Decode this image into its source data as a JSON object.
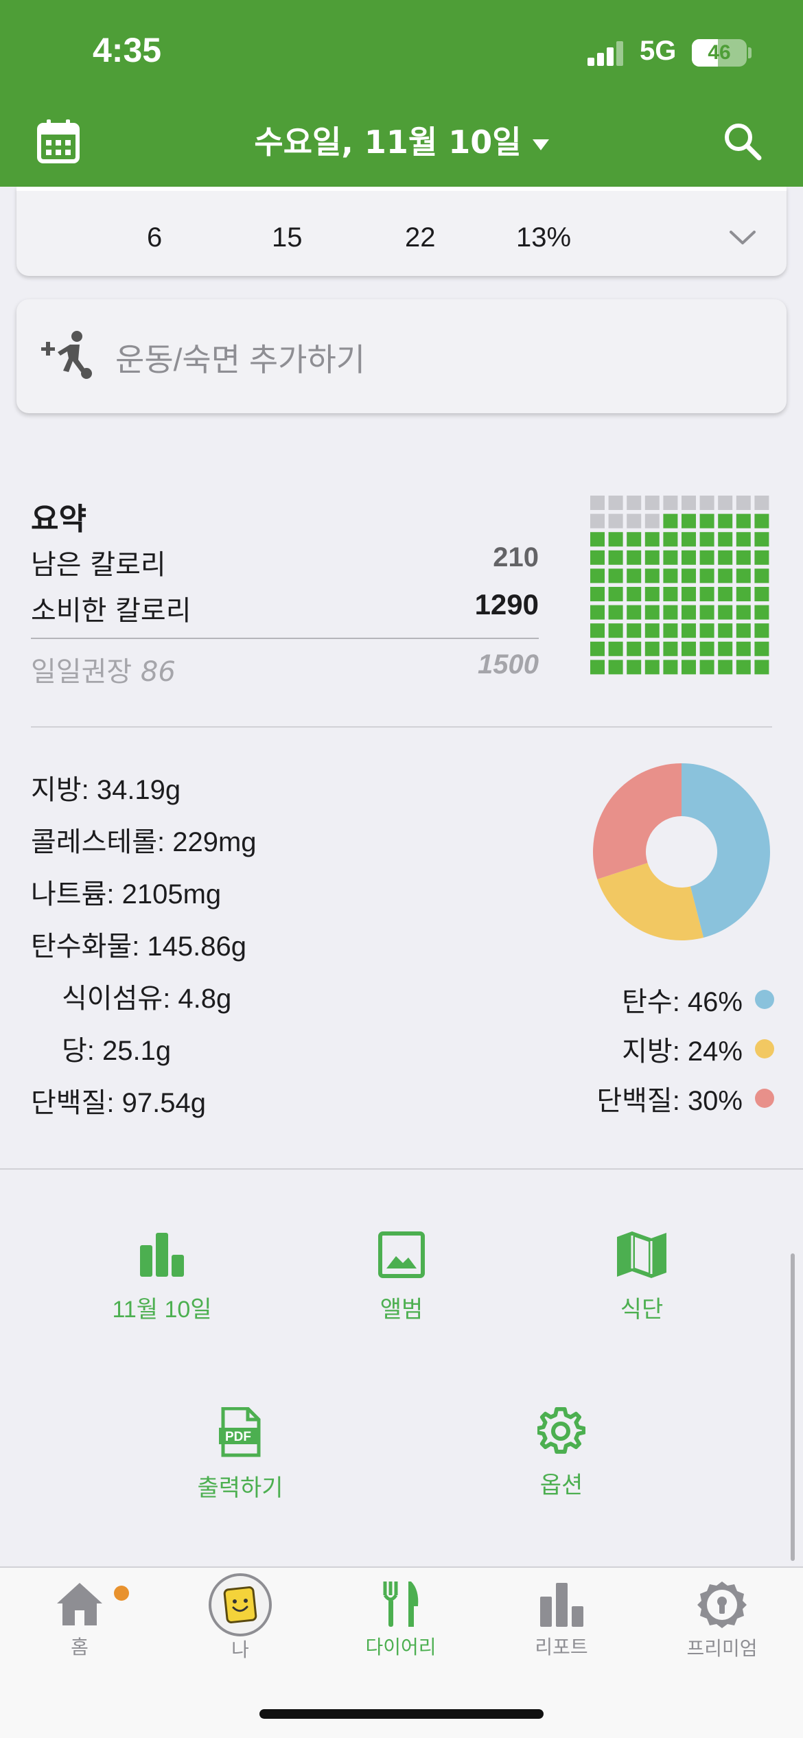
{
  "status_bar": {
    "time": "4:35",
    "network": "5G",
    "battery": "46"
  },
  "header": {
    "date_title": "수요일, 11월 10일",
    "calendar_icon": "calendar-icon",
    "search_icon": "search-icon"
  },
  "macros_row": {
    "values": [
      "6",
      "15",
      "22",
      "13%"
    ]
  },
  "exercise": {
    "label": "운동/숙면 추가하기"
  },
  "summary": {
    "title": "요약",
    "remaining_label": "남은 칼로리",
    "remaining_value": "210",
    "consumed_label": "소비한 칼로리",
    "consumed_value": "1290",
    "daily_label": "일일권장",
    "daily_pct": "86",
    "daily_value": "1500",
    "waffle_filled_fraction": 0.86
  },
  "nutrients": {
    "fat": "지방: 34.19g",
    "cholesterol": "콜레스테롤: 229mg",
    "sodium": "나트륨: 2105mg",
    "carbs": "탄수화물: 145.86g",
    "fiber": "식이섬유: 4.8g",
    "sugar": "당: 25.1g",
    "protein": "단백질: 97.54g"
  },
  "chart_data": {
    "type": "pie",
    "categories": [
      "탄수",
      "지방",
      "단백질"
    ],
    "values": [
      46,
      24,
      30
    ],
    "colors": [
      "#8ac2dc",
      "#f2c862",
      "#e8908a"
    ],
    "legend": [
      "탄수: 46%",
      "지방: 24%",
      "단백질: 30%"
    ]
  },
  "actions": {
    "report_date": "11월 10일",
    "album": "앨범",
    "meal_plan": "식단",
    "export": "출력하기",
    "options": "옵션"
  },
  "tabs": {
    "home": "홈",
    "me": "나",
    "diary": "다이어리",
    "report": "리포트",
    "premium": "프리미엄"
  },
  "colors": {
    "brand_green": "#4e9e37",
    "action_green": "#4caf50",
    "notification": "#e8922e"
  }
}
